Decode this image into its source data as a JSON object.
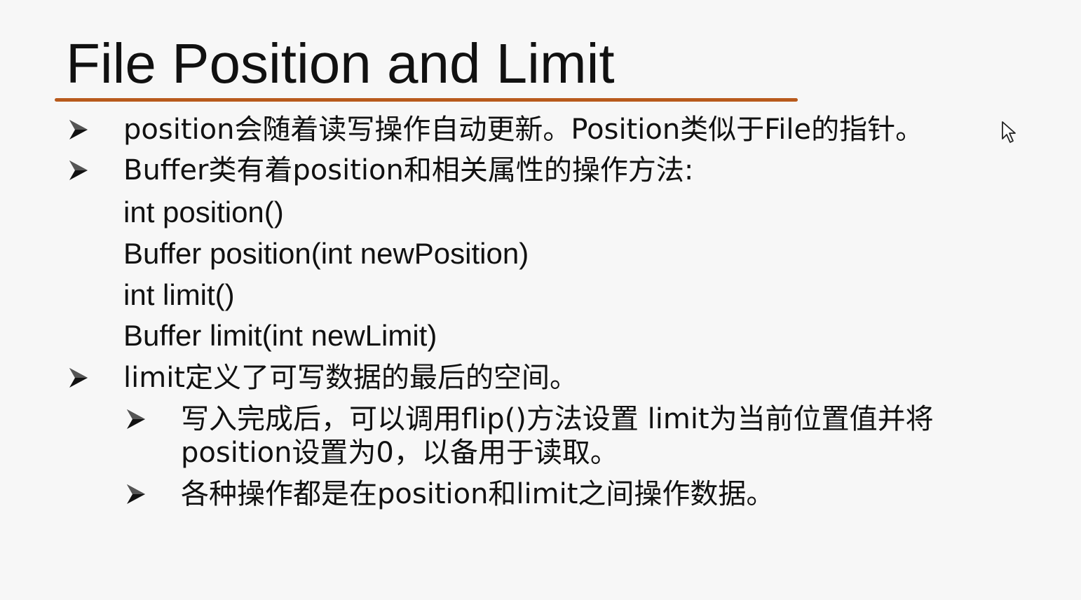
{
  "slide": {
    "title": "File Position and Limit",
    "accent_color": "#b85a1c",
    "bullets": [
      {
        "icon": "arrow-bullet-icon",
        "text": "position会随着读写操作自动更新。Position类似于File的指针。"
      },
      {
        "icon": "arrow-bullet-icon",
        "text": "Buffer类有着position和相关属性的操作方法:"
      }
    ],
    "methods": [
      "int position()",
      "Buffer position(int newPosition)",
      "int limit()",
      "Buffer limit(int newLimit)"
    ],
    "bullet3": {
      "icon": "arrow-bullet-icon",
      "text": "limit定义了可写数据的最后的空间。"
    },
    "sub_bullets": [
      {
        "icon": "arrow-bullet-icon",
        "line1": "写入完成后，可以调用flip()方法设置 limit为当前位置值并将",
        "line2": "position设置为0，以备用于读取。"
      },
      {
        "icon": "arrow-bullet-icon",
        "line1": "各种操作都是在position和limit之间操作数据。"
      }
    ]
  },
  "cursor": {
    "icon": "mouse-pointer-icon"
  }
}
